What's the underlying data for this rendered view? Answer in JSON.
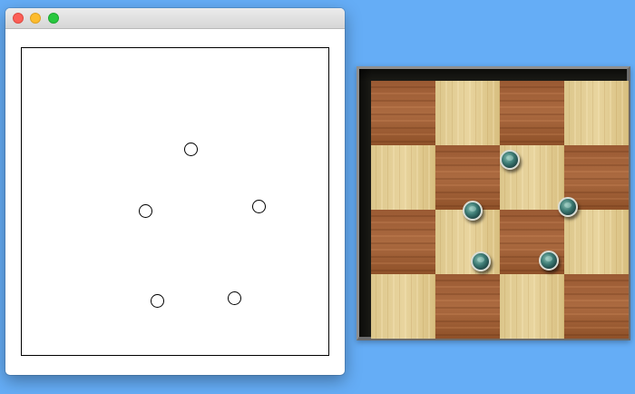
{
  "window": {
    "title": "",
    "traffic_lights": [
      "close",
      "minimize",
      "zoom"
    ],
    "colors": {
      "close": "#fc5f57",
      "minimize": "#fdbc2e",
      "zoom": "#28c83f"
    }
  },
  "plot_panel": {
    "markers": [
      {
        "name": "marker-1"
      },
      {
        "name": "marker-2"
      },
      {
        "name": "marker-3"
      },
      {
        "name": "marker-4"
      },
      {
        "name": "marker-5"
      }
    ]
  },
  "board": {
    "rows": 4,
    "cols": 4,
    "square_colors": {
      "light": "#e2cd96",
      "dark": "#a4643b"
    },
    "pieces": [
      {
        "row": 1,
        "col": 2
      },
      {
        "row": 2,
        "col": 1
      },
      {
        "row": 2,
        "col": 3
      },
      {
        "row": 3,
        "col": 1
      },
      {
        "row": 3,
        "col": 2
      }
    ]
  },
  "desktop": {
    "background_color": "#65adf6"
  }
}
